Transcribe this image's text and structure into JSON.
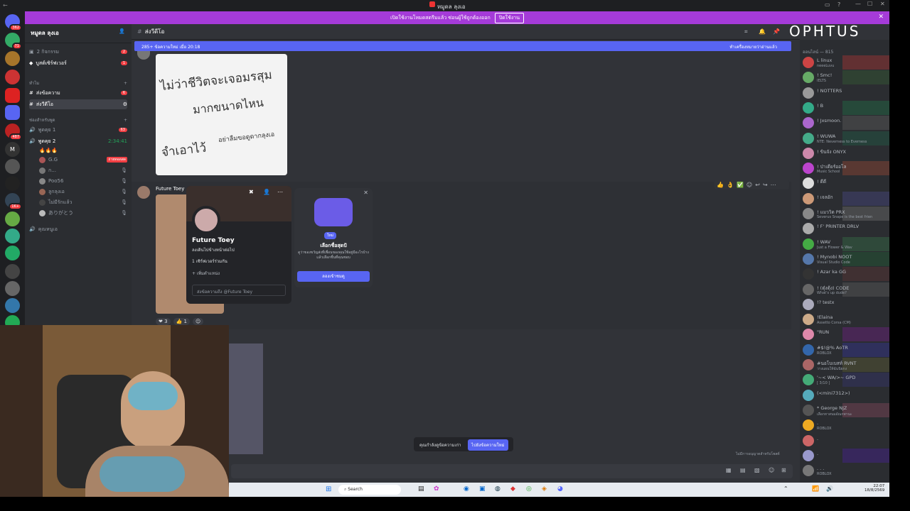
{
  "window": {
    "title": "หมูดล ลุงเอ",
    "logo": "OPHTUS"
  },
  "banner": {
    "text": "เปิดใช้งานโหมดสตรีมแล้ว ซ่อนผู้ใช้ถูกต้องออก",
    "button": "ปิดใช้งาน"
  },
  "server": {
    "name": "หมูดล ลุงเอ",
    "rail_badges": [
      "362",
      "71",
      "487",
      "1K+"
    ]
  },
  "channels": {
    "events": "2 กิจกรรม",
    "events_count": "2",
    "boost": "บูสต์เซิร์ฟเวอร์",
    "boost_count": "1",
    "section1": "ทำไม",
    "ch1": "ส่งข้อความ",
    "ch1_count": "6",
    "ch2": "ส่งวีดีโอ",
    "section2": "ช่องสำหรับพูด",
    "voice1": "พูดคุย 1",
    "voice1_count": "63",
    "voice2": "พูดคุย 2",
    "voice2_time": "2:34:41",
    "voice2_emoji": "🔥🔥🔥",
    "users": [
      "G.G",
      "ก...",
      "Poo56",
      "ลูกลุงเอ",
      "ไม่มีรักแล้ว",
      "ありがとう"
    ],
    "live_badge": "ถ่ายทอดสด",
    "voice3": "คุณหนูเอ"
  },
  "header": {
    "channel": "ส่งวีดีโอ"
  },
  "newmsg": {
    "left": "285+ ข้อความใหม่ เมื่อ 20:18",
    "right": "ทำเครื่องหมายว่าอ่านแล้ว"
  },
  "image_text": {
    "l1": "ไม่ว่าชีวิตจะเจอมรสุม",
    "l2": "มากขนาดไหน",
    "l3": "จำเอาไว้",
    "l4": "อย่าลืมขอดูดากลุงเอ"
  },
  "message": {
    "author": "Future Toey",
    "reactions": [
      {
        "emoji": "❤",
        "count": "3"
      },
      {
        "emoji": "👍",
        "count": "1"
      }
    ]
  },
  "profile": {
    "name": "Future Toey",
    "status": "ลงเดินไปข้างหน้าต่อไป",
    "sub": "1 เซิร์ฟเวอร์ร่วมกัน",
    "note": "+ เพิ่มตำแหน่ง",
    "input": "ส่งข้อความถึง @Future Toey"
  },
  "nitro": {
    "badge": "ใหม่",
    "title": "เลือกชื่อสุดปั",
    "desc": "ดูว่าของขวัญส่งที่เพื่อนของคุณใช้อยู่มีอะไรบ้าง แล้วเลือกชิ้นที่คุณชอบ",
    "button": "ลองเข้าชมดู"
  },
  "toast": {
    "text": "คุณกำลังดูข้อความเก่า",
    "button": "ไปยังข้อความใหม่"
  },
  "composer_hint": "ไม่มีการอนุญาตสำหรับโพสต์",
  "members": {
    "header": "ออนไลน์ — 815",
    "list": [
      {
        "name": "L linux",
        "status": "neeeLuvu"
      },
      {
        "name": "! Smc!",
        "status": "IELTS"
      },
      {
        "name": "! NOTTERS",
        "status": ""
      },
      {
        "name": "! B",
        "status": ""
      },
      {
        "name": "! Jxsmoon.",
        "status": ""
      },
      {
        "name": "! WUWA",
        "status": "NTE: Neverness to Everness"
      },
      {
        "name": "! ขินจัง ONYX",
        "status": ""
      },
      {
        "name": "! ป่าเดียร์ออโล",
        "status": "Music School"
      },
      {
        "name": "! ดีดี",
        "status": ""
      },
      {
        "name": "! เจลอัก",
        "status": ""
      },
      {
        "name": "! แมววิด PRX",
        "status": "Severus Snape is the best frien"
      },
      {
        "name": "! F' PRINTER DRLV",
        "status": ""
      },
      {
        "name": "! WAV",
        "status": "Just a Flower & Wav"
      },
      {
        "name": "! Mynobi NOOT",
        "status": "Visual Studio Code"
      },
      {
        "name": "! Azar ka GG",
        "status": ""
      },
      {
        "name": "! (ตุ๋งตุ้ง) CODE",
        "status": "What's up dude?"
      },
      {
        "name": "!? testx",
        "status": ""
      },
      {
        "name": "!Elaina",
        "status": "Assetto Corsa (CM)"
      },
      {
        "name": "\"RUN",
        "status": ""
      },
      {
        "name": "#$!@% AoTR",
        "status": "ROBLOX"
      },
      {
        "name": "#นอโบเบสท์ RVNT",
        "status": "วางแผนให้ฉันนิยกง"
      },
      {
        "name": "'~< WA/>~ GPD",
        "status": "[ 3/10 ]"
      },
      {
        "name": "(<mini7312>)",
        "status": ""
      },
      {
        "name": "* George NJZ",
        "status": "เลือกหาสนมอัณกพานะ"
      },
      {
        "name": ".",
        "status": "ROBLOX"
      },
      {
        "name": ".",
        "status": ""
      },
      {
        "name": ".",
        "status": ""
      },
      {
        "name": ". . .",
        "status": "ROBLOX"
      }
    ]
  },
  "taskbar": {
    "search": "Search",
    "time": "22:07",
    "date": "18/8/2569"
  }
}
